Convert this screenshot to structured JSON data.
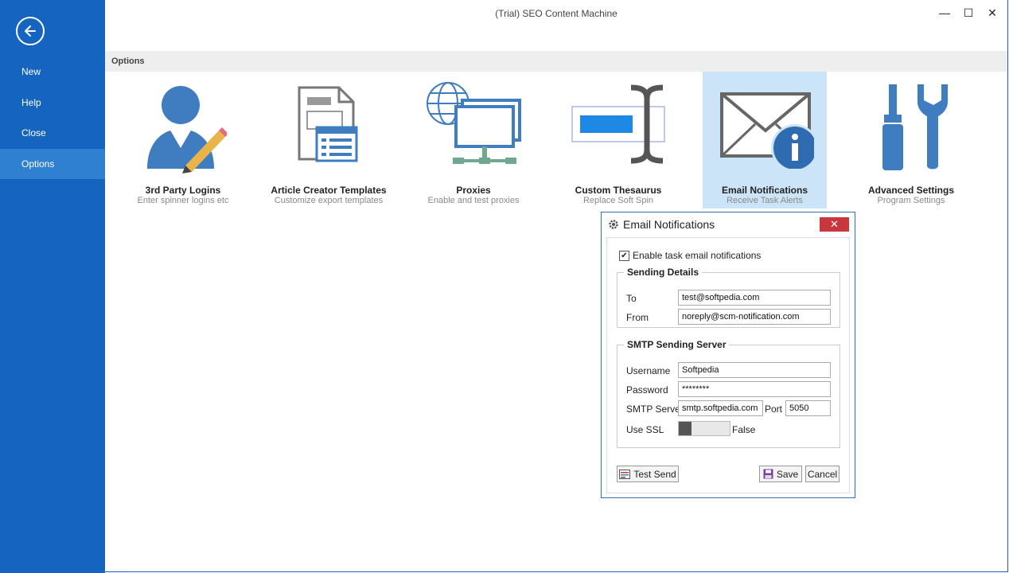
{
  "window": {
    "title": "(Trial) SEO Content Machine",
    "minimize_glyph": "—",
    "maximize_glyph": "☐",
    "close_glyph": "✕"
  },
  "sidebar": {
    "back_icon": "arrow-left-icon",
    "items": [
      {
        "label": "New",
        "active": false
      },
      {
        "label": "Help",
        "active": false
      },
      {
        "label": "Close",
        "active": false
      },
      {
        "label": "Options",
        "active": true
      }
    ]
  },
  "options_header": "Options",
  "tiles": [
    {
      "title": "3rd Party Logins",
      "subtitle": "Enter spinner logins etc",
      "icon": "user-pencil-icon"
    },
    {
      "title": "Article Creator Templates",
      "subtitle": "Customize export templates",
      "icon": "document-template-icon"
    },
    {
      "title": "Proxies",
      "subtitle": "Enable and test proxies",
      "icon": "globe-network-icon"
    },
    {
      "title": "Custom Thesaurus",
      "subtitle": "Replace Soft Spin",
      "icon": "text-cursor-icon"
    },
    {
      "title": "Email Notifications",
      "subtitle": "Receive Task Alerts",
      "icon": "envelope-info-icon",
      "selected": true
    },
    {
      "title": "Advanced Settings",
      "subtitle": "Program Settings",
      "icon": "tools-icon"
    }
  ],
  "dialog": {
    "title": "Email Notifications",
    "close_glyph": "✕",
    "enable_label": "Enable task email notifications",
    "enable_checked": true,
    "sending_details": {
      "legend": "Sending Details",
      "to_label": "To",
      "to_value": "test@softpedia.com",
      "from_label": "From",
      "from_value": "noreply@scm-notification.com"
    },
    "smtp": {
      "legend": "SMTP Sending Server",
      "username_label": "Username",
      "username_value": "Softpedia",
      "password_label": "Password",
      "password_value": "********",
      "server_label": "SMTP Server",
      "server_value": "smtp.softpedia.com",
      "port_label": "Port",
      "port_value": "5050",
      "ssl_label": "Use SSL",
      "ssl_value": "False"
    },
    "test_send": "Test Send",
    "save": "Save",
    "cancel": "Cancel"
  },
  "colors": {
    "sidebar": "#1565C0",
    "sidebar_active": "#2F80D0",
    "icon_blue": "#3F7CC0",
    "tile_selected": "#CCE4F7",
    "dialog_close": "#C8373B"
  }
}
